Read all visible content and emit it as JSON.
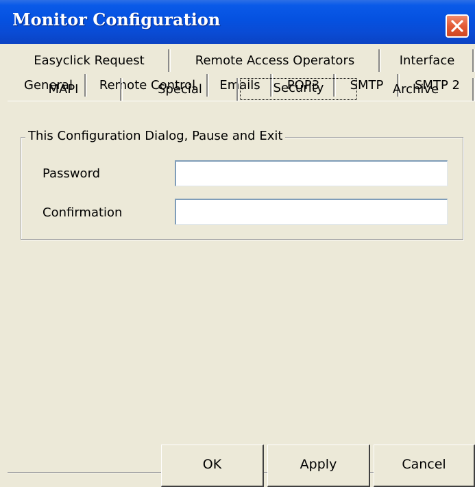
{
  "window": {
    "title": "Monitor Configuration"
  },
  "tabs": {
    "row1": [
      "Easyclick Request",
      "Remote Access Operators",
      "Interface"
    ],
    "row2": [
      "General",
      "Remote Control",
      "Emails",
      "POP3",
      "SMTP",
      "SMTP 2"
    ],
    "row3": [
      "MAPI",
      "Special",
      "Security",
      "Archive"
    ],
    "active": "Security"
  },
  "security_group": {
    "title": "This Configuration Dialog, Pause and Exit",
    "password_label": "Password",
    "password_value": "",
    "confirmation_label": "Confirmation",
    "confirmation_value": ""
  },
  "buttons": {
    "ok": "OK",
    "apply": "Apply",
    "cancel": "Cancel"
  },
  "colors": {
    "titlebar": "#0a55e0",
    "dialog_background": "#ece9d8",
    "close_button": "#e04f2a"
  },
  "icons": {
    "close": "close-icon"
  }
}
